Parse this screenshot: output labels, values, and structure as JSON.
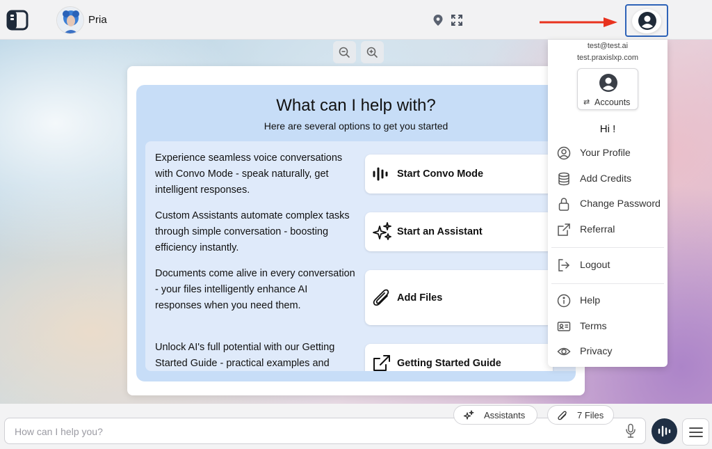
{
  "header": {
    "bot_name": "Pria"
  },
  "help_card": {
    "title": "What can I help with?",
    "subtitle": "Here are several options to get you started",
    "options": [
      {
        "text": "Experience seamless voice conversations with Convo Mode - speak naturally, get intelligent responses.",
        "button": "Start Convo Mode",
        "icon": "waveform-icon"
      },
      {
        "text": "Custom Assistants automate complex tasks through simple conversation - boosting efficiency instantly.",
        "button": "Start an Assistant",
        "icon": "sparkles-icon"
      },
      {
        "text": "Documents come alive in every conversation - your files intelligently enhance AI responses when you need them.",
        "button": "Add Files",
        "icon": "paperclip-icon"
      },
      {
        "text": "Unlock AI's full potential with our Getting Started Guide - practical examples and",
        "button": "Getting Started Guide",
        "icon": "external-link-icon"
      }
    ]
  },
  "account_menu": {
    "email": "test@test.ai",
    "domain": "test.praxislxp.com",
    "accounts_label": "Accounts",
    "greeting": "Hi !",
    "items": [
      {
        "label": "Your Profile",
        "icon": "user-circle-icon"
      },
      {
        "label": "Add Credits",
        "icon": "database-icon"
      },
      {
        "label": "Change Password",
        "icon": "lock-icon"
      },
      {
        "label": "Referral",
        "icon": "external-link-icon"
      },
      {
        "label": "Logout",
        "icon": "logout-icon"
      },
      {
        "label": "Help",
        "icon": "info-icon"
      },
      {
        "label": "Terms",
        "icon": "id-card-icon"
      },
      {
        "label": "Privacy",
        "icon": "eye-icon"
      }
    ]
  },
  "composer": {
    "placeholder": "How can I help you?",
    "assistants_chip": "Assistants",
    "files_chip": "7 Files"
  },
  "colors": {
    "highlight_border": "#2e63b8",
    "arrow": "#e8321e",
    "card_panel": "#c7ddf7",
    "voice_button": "#1f2f44"
  }
}
